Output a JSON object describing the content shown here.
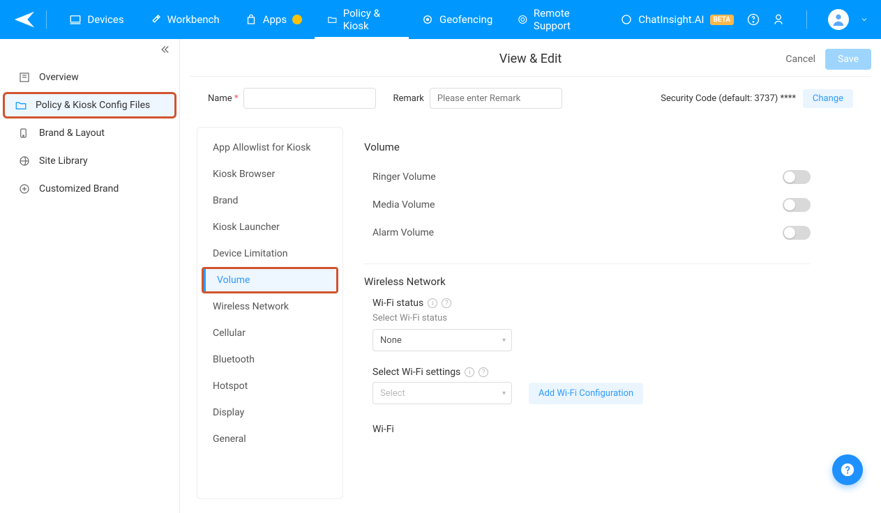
{
  "topnav": {
    "items": [
      {
        "label": "Devices"
      },
      {
        "label": "Workbench"
      },
      {
        "label": "Apps"
      },
      {
        "label": "Policy & Kiosk"
      },
      {
        "label": "Geofencing"
      },
      {
        "label": "Remote Support"
      },
      {
        "label": "ChatInsight.AI"
      }
    ],
    "beta_badge": "BETA"
  },
  "sidebar": {
    "items": [
      {
        "label": "Overview"
      },
      {
        "label": "Policy & Kiosk Config Files"
      },
      {
        "label": "Brand & Layout"
      },
      {
        "label": "Site Library"
      },
      {
        "label": "Customized Brand"
      }
    ]
  },
  "header": {
    "title": "View & Edit",
    "cancel": "Cancel",
    "save": "Save"
  },
  "form": {
    "name_label": "Name",
    "name_value": "",
    "remark_label": "Remark",
    "remark_placeholder": "Please enter Remark",
    "security_label": "Security Code (default: 3737) ****",
    "change_label": "Change"
  },
  "sections": [
    "App Allowlist for Kiosk",
    "Kiosk Browser",
    "Brand",
    "Kiosk Launcher",
    "Device Limitation",
    "Volume",
    "Wireless Network",
    "Cellular",
    "Bluetooth",
    "Hotspot",
    "Display",
    "General"
  ],
  "settings": {
    "volume_title": "Volume",
    "ringer": "Ringer Volume",
    "media": "Media Volume",
    "alarm": "Alarm Volume",
    "wireless_title": "Wireless Network",
    "wifi_status_label": "Wi-Fi status",
    "wifi_status_hint": "Select Wi-Fi status",
    "wifi_status_value": "None",
    "wifi_settings_label": "Select Wi-Fi settings",
    "wifi_settings_value": "Select",
    "add_wifi": "Add Wi-Fi Configuration",
    "wifi_section": "Wi-Fi"
  }
}
